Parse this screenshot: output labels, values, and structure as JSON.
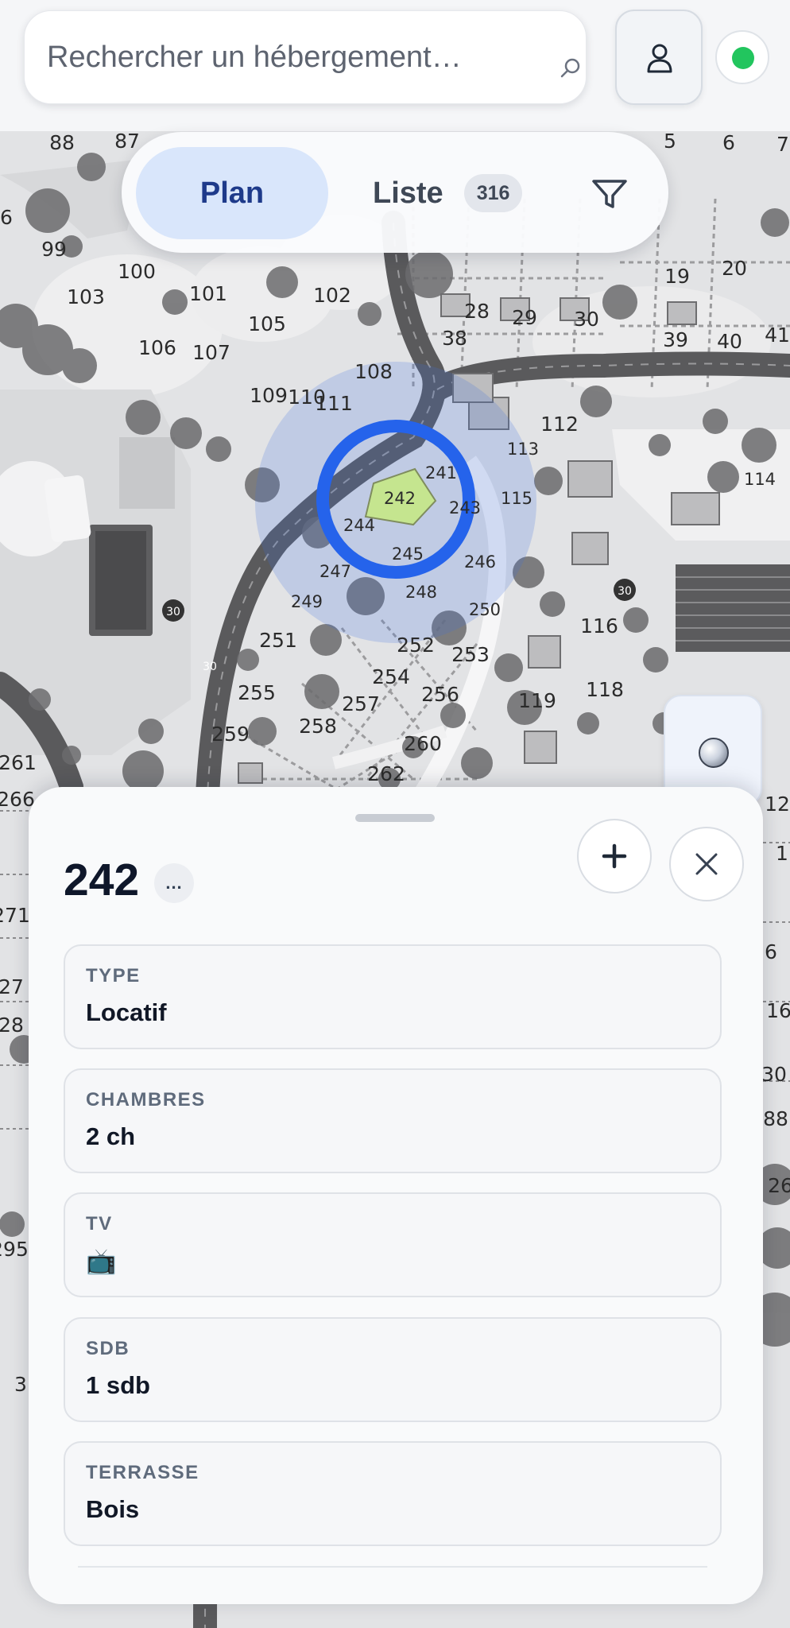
{
  "search": {
    "placeholder": "Rechercher un hébergement…"
  },
  "header": {
    "profile_icon": "user-icon",
    "status_color": "#22c55e"
  },
  "view_toggle": {
    "plan_label": "Plan",
    "liste_label": "Liste",
    "liste_count": "316",
    "filter_icon": "filter-icon"
  },
  "map": {
    "lot_labels": [
      "88",
      "87",
      "5",
      "6",
      "7",
      "6",
      "99",
      "100",
      "103",
      "101",
      "102",
      "105",
      "28",
      "29",
      "30",
      "38",
      "19",
      "20",
      "39",
      "40",
      "41",
      "106",
      "107",
      "108",
      "109",
      "110",
      "111",
      "112",
      "113",
      "241",
      "242",
      "243",
      "244",
      "115",
      "114",
      "245",
      "246",
      "247",
      "248",
      "249",
      "250",
      "251",
      "252",
      "253",
      "116",
      "254",
      "255",
      "256",
      "257",
      "258",
      "259",
      "260",
      "261",
      "262",
      "266",
      "119",
      "118",
      "30",
      "30",
      "30",
      "12",
      "1",
      "6",
      "16",
      "271",
      "27",
      "28",
      "30",
      "88",
      "295",
      "26",
      "3"
    ],
    "selected_lot": "242",
    "accent_color": "#2563eb",
    "highlight_color": "#c5e58f"
  },
  "detail": {
    "title": "242",
    "more_label": "...",
    "fields": [
      {
        "label": "TYPE",
        "value": "Locatif"
      },
      {
        "label": "CHAMBRES",
        "value": "2 ch"
      },
      {
        "label": "TV",
        "value": "📺"
      },
      {
        "label": "SDB",
        "value": "1 sdb"
      },
      {
        "label": "TERRASSE",
        "value": "Bois"
      }
    ]
  }
}
